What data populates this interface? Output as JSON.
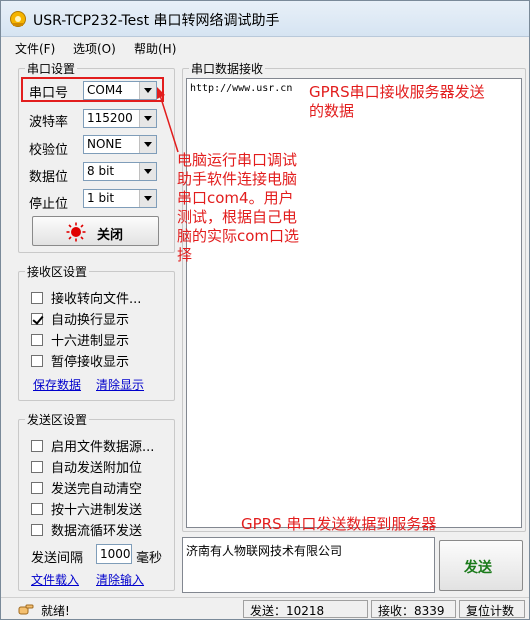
{
  "title": "USR-TCP232-Test 串口转网络调试助手",
  "menu": {
    "file": "文件(F)",
    "options": "选项(O)",
    "help": "帮助(H)"
  },
  "serial_settings": {
    "title": "串口设置",
    "port": {
      "label": "串口号",
      "value": "COM4"
    },
    "baud": {
      "label": "波特率",
      "value": "115200"
    },
    "parity": {
      "label": "校验位",
      "value": "NONE"
    },
    "databits": {
      "label": "数据位",
      "value": "8 bit"
    },
    "stopbits": {
      "label": "停止位",
      "value": "1 bit"
    },
    "close_button": "关闭"
  },
  "receive_settings": {
    "title": "接收区设置",
    "options": [
      {
        "label": "接收转向文件...",
        "checked": false
      },
      {
        "label": "自动换行显示",
        "checked": true
      },
      {
        "label": "十六进制显示",
        "checked": false
      },
      {
        "label": "暂停接收显示",
        "checked": false
      }
    ],
    "save_link": "保存数据",
    "clear_link": "清除显示"
  },
  "send_settings": {
    "title": "发送区设置",
    "options": [
      {
        "label": "启用文件数据源...",
        "checked": false
      },
      {
        "label": "自动发送附加位",
        "checked": false
      },
      {
        "label": "发送完自动清空",
        "checked": false
      },
      {
        "label": "按十六进制发送",
        "checked": false
      },
      {
        "label": "数据流循环发送",
        "checked": false
      }
    ],
    "interval_label": "发送间隔",
    "interval_value": "1000",
    "interval_unit": "毫秒",
    "load_file_link": "文件载入",
    "clear_input_link": "清除输入"
  },
  "receive_panel": {
    "title": "串口数据接收",
    "content": "http://www.usr.cn"
  },
  "send_panel": {
    "content": "济南有人物联网技术有限公司",
    "send_button": "发送"
  },
  "annotations": {
    "receive_note": "GPRS串口接收服务器发送的数据",
    "left_note": "电脑运行串口调试助手软件连接电脑串口com4。用户测试，根据自己电脑的实际com口选择",
    "send_note": "GPRS 串口发送数据到服务器"
  },
  "status": {
    "ready": "就绪!",
    "sent": "发送：10218",
    "received": "接收：8339",
    "reset": "复位计数"
  },
  "colors": {
    "annotation_red": "#e21d1d",
    "send_button_text": "#1a7a1a",
    "link_blue": "#0000cc"
  }
}
